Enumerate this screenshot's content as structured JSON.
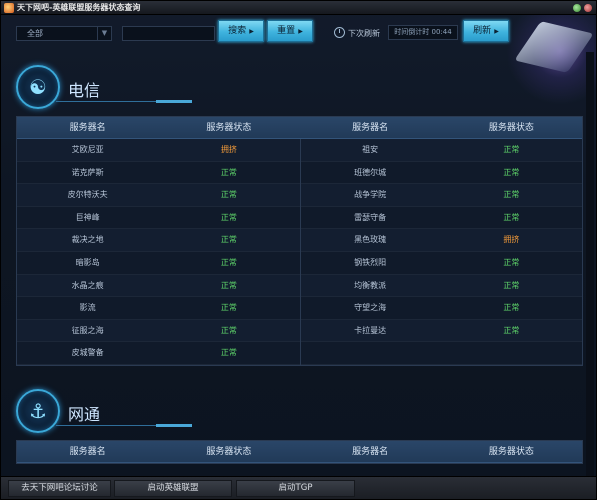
{
  "window": {
    "title": "天下网吧-英雄联盟服务器状态查询"
  },
  "toolbar": {
    "region_select": "全部",
    "search_label": "搜索",
    "reset_label": "重置",
    "next_refresh_label": "下次刷新",
    "countdown": "时间倒计时 00:44",
    "refresh_label": "刷新"
  },
  "sections": [
    {
      "title": "电信",
      "headers": [
        "服务器名",
        "服务器状态",
        "服务器名",
        "服务器状态"
      ],
      "rows": [
        {
          "left_name": "艾欧尼亚",
          "left_status": "拥挤",
          "left_state": "busy",
          "right_name": "祖安",
          "right_status": "正常",
          "right_state": "ok"
        },
        {
          "left_name": "诺克萨斯",
          "left_status": "正常",
          "left_state": "ok",
          "right_name": "班德尔城",
          "right_status": "正常",
          "right_state": "ok"
        },
        {
          "left_name": "皮尔特沃夫",
          "left_status": "正常",
          "left_state": "ok",
          "right_name": "战争学院",
          "right_status": "正常",
          "right_state": "ok"
        },
        {
          "left_name": "巨神峰",
          "left_status": "正常",
          "left_state": "ok",
          "right_name": "雷瑟守备",
          "right_status": "正常",
          "right_state": "ok"
        },
        {
          "left_name": "裁决之地",
          "left_status": "正常",
          "left_state": "ok",
          "right_name": "黑色玫瑰",
          "right_status": "拥挤",
          "right_state": "busy"
        },
        {
          "left_name": "暗影岛",
          "left_status": "正常",
          "left_state": "ok",
          "right_name": "钢铁烈阳",
          "right_status": "正常",
          "right_state": "ok"
        },
        {
          "left_name": "水晶之痕",
          "left_status": "正常",
          "left_state": "ok",
          "right_name": "均衡教派",
          "right_status": "正常",
          "right_state": "ok"
        },
        {
          "left_name": "影流",
          "left_status": "正常",
          "left_state": "ok",
          "right_name": "守望之海",
          "right_status": "正常",
          "right_state": "ok"
        },
        {
          "left_name": "征服之海",
          "left_status": "正常",
          "left_state": "ok",
          "right_name": "卡拉曼达",
          "right_status": "正常",
          "right_state": "ok"
        },
        {
          "left_name": "皮城警备",
          "left_status": "正常",
          "left_state": "ok",
          "right_name": "",
          "right_status": "",
          "right_state": ""
        }
      ]
    },
    {
      "title": "网通",
      "headers": [
        "服务器名",
        "服务器状态",
        "服务器名",
        "服务器状态"
      ],
      "rows": []
    }
  ],
  "bottom_bar": {
    "forum_label": "去天下网吧论坛讨论",
    "launch_lol_label": "启动英雄联盟",
    "launch_tgp_label": "启动TGP"
  }
}
